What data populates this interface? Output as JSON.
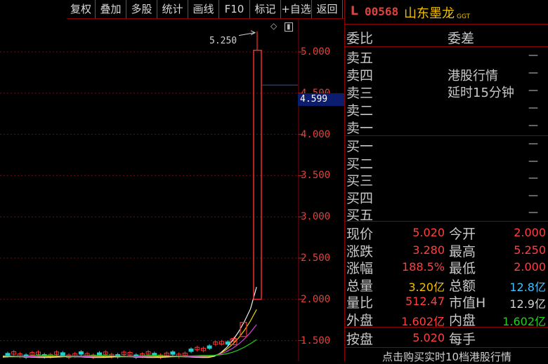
{
  "toolbar": {
    "buttons": [
      "复权",
      "叠加",
      "多股",
      "统计",
      "画线",
      "F10",
      "标记",
      "+自选",
      "返回"
    ]
  },
  "chart": {
    "y_ticks": [
      "5.000",
      "4.500",
      "4.000",
      "3.500",
      "3.000",
      "2.500",
      "2.000",
      "1.500"
    ],
    "current_price": "4.599",
    "peak_label": "5.250"
  },
  "chart_data": {
    "type": "candlestick",
    "ylim": [
      1.25,
      5.4
    ],
    "y_ticks": [
      1.5,
      2.0,
      2.5,
      3.0,
      3.5,
      4.0,
      4.5,
      5.0
    ],
    "last_candle": {
      "open": 2.0,
      "high": 5.25,
      "low": 2.0,
      "close": 5.02
    },
    "current_price": 4.599,
    "peak": 5.25
  },
  "quote": {
    "market_flag": "L",
    "code": "00568",
    "name": "山东墨龙",
    "tag": "GGT",
    "weibi_label": "委比",
    "weicha_label": "委差",
    "sell_labels": [
      "卖五",
      "卖四",
      "卖三",
      "卖二",
      "卖一"
    ],
    "buy_labels": [
      "买一",
      "买二",
      "买三",
      "买四",
      "买五"
    ],
    "dash": "—",
    "notice_line1": "港股行情",
    "notice_line2": "延时15分钟",
    "stats": [
      {
        "l1": "现价",
        "v1": "5.020",
        "c1": "#ff4040",
        "l2": "今开",
        "v2": "2.000",
        "c2": "#ff4040"
      },
      {
        "l1": "涨跌",
        "v1": "3.280",
        "c1": "#ff4040",
        "l2": "最高",
        "v2": "5.250",
        "c2": "#ff4040"
      },
      {
        "l1": "涨幅",
        "v1": "188.5%",
        "c1": "#ff4040",
        "l2": "最低",
        "v2": "2.000",
        "c2": "#ff4040"
      },
      {
        "l1": "总量",
        "v1": "3.20亿",
        "c1": "#f0c000",
        "l2": "总额",
        "v2": "12.8亿",
        "c2": "#40c0ff"
      },
      {
        "l1": "量比",
        "v1": "512.47",
        "c1": "#ff4040",
        "l2": "市值H",
        "v2": "12.9亿",
        "c2": "#d0d0d0"
      },
      {
        "l1": "外盘",
        "v1": "1.602亿",
        "c1": "#ff4040",
        "l2": "内盘",
        "v2": "1.602亿",
        "c2": "#20d020"
      }
    ],
    "anpan_label": "按盘",
    "anpan_value": "5.020",
    "meishou_label": "每手",
    "footer": "点击购买实时10档港股行情"
  }
}
